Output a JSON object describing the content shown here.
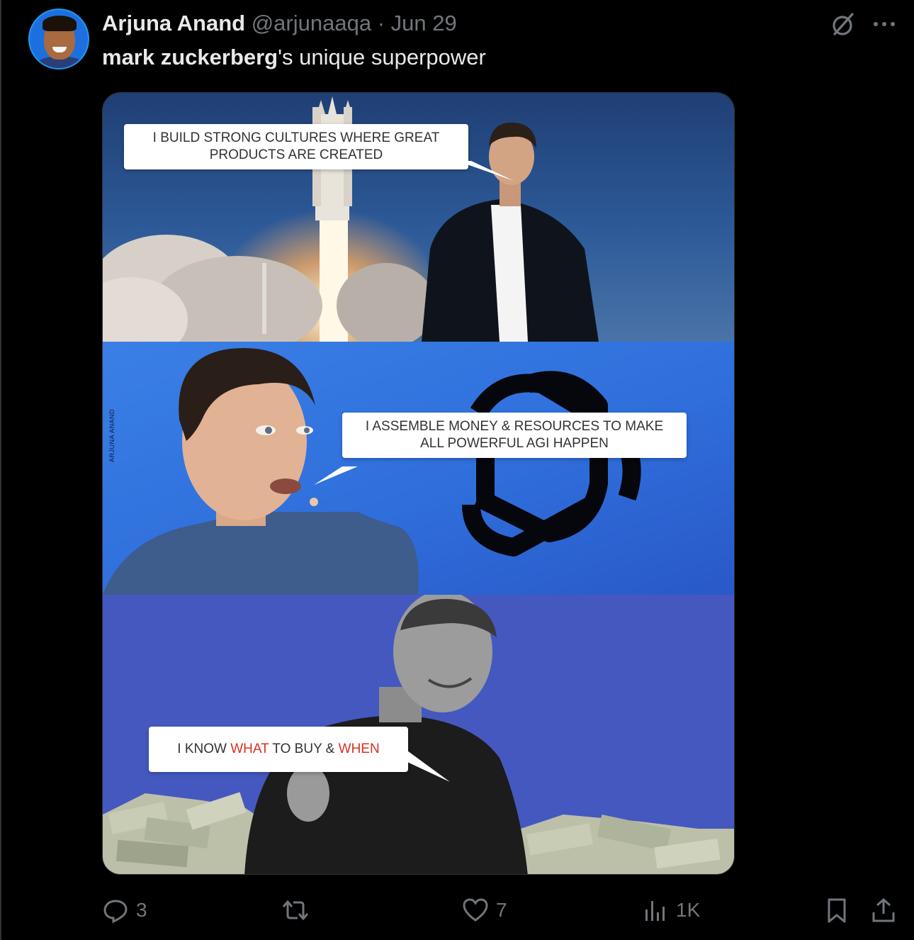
{
  "tweet": {
    "author_name": "Arjuna Anand",
    "handle": "@arjunaaqa",
    "separator": "·",
    "date": "Jun 29",
    "text_bold": "mark zuckerberg",
    "text_rest": "'s unique superpower"
  },
  "media": {
    "panel1": {
      "bubble_text": "I BUILD STRONG CULTURES WHERE GREAT PRODUCTS ARE CREATED"
    },
    "panel2": {
      "bubble_text": "I ASSEMBLE MONEY & RESOURCES TO MAKE ALL POWERFUL AGI HAPPEN",
      "watermark": "ARJUNA ANAND"
    },
    "panel3": {
      "bubble_part1": "I KNOW ",
      "bubble_red1": "WHAT",
      "bubble_part2": " TO BUY & ",
      "bubble_red2": "WHEN"
    }
  },
  "actions": {
    "replies": "3",
    "retweets": "",
    "likes": "7",
    "views": "1K"
  },
  "icons": {
    "grok": "grok-icon",
    "more": "more-icon",
    "reply": "reply-icon",
    "retweet": "retweet-icon",
    "like": "heart-icon",
    "views": "views-icon",
    "bookmark": "bookmark-icon",
    "share": "share-icon"
  },
  "colors": {
    "background": "#000000",
    "text": "#e7e9ea",
    "muted": "#71767b",
    "highlight_red": "#d8321e"
  }
}
